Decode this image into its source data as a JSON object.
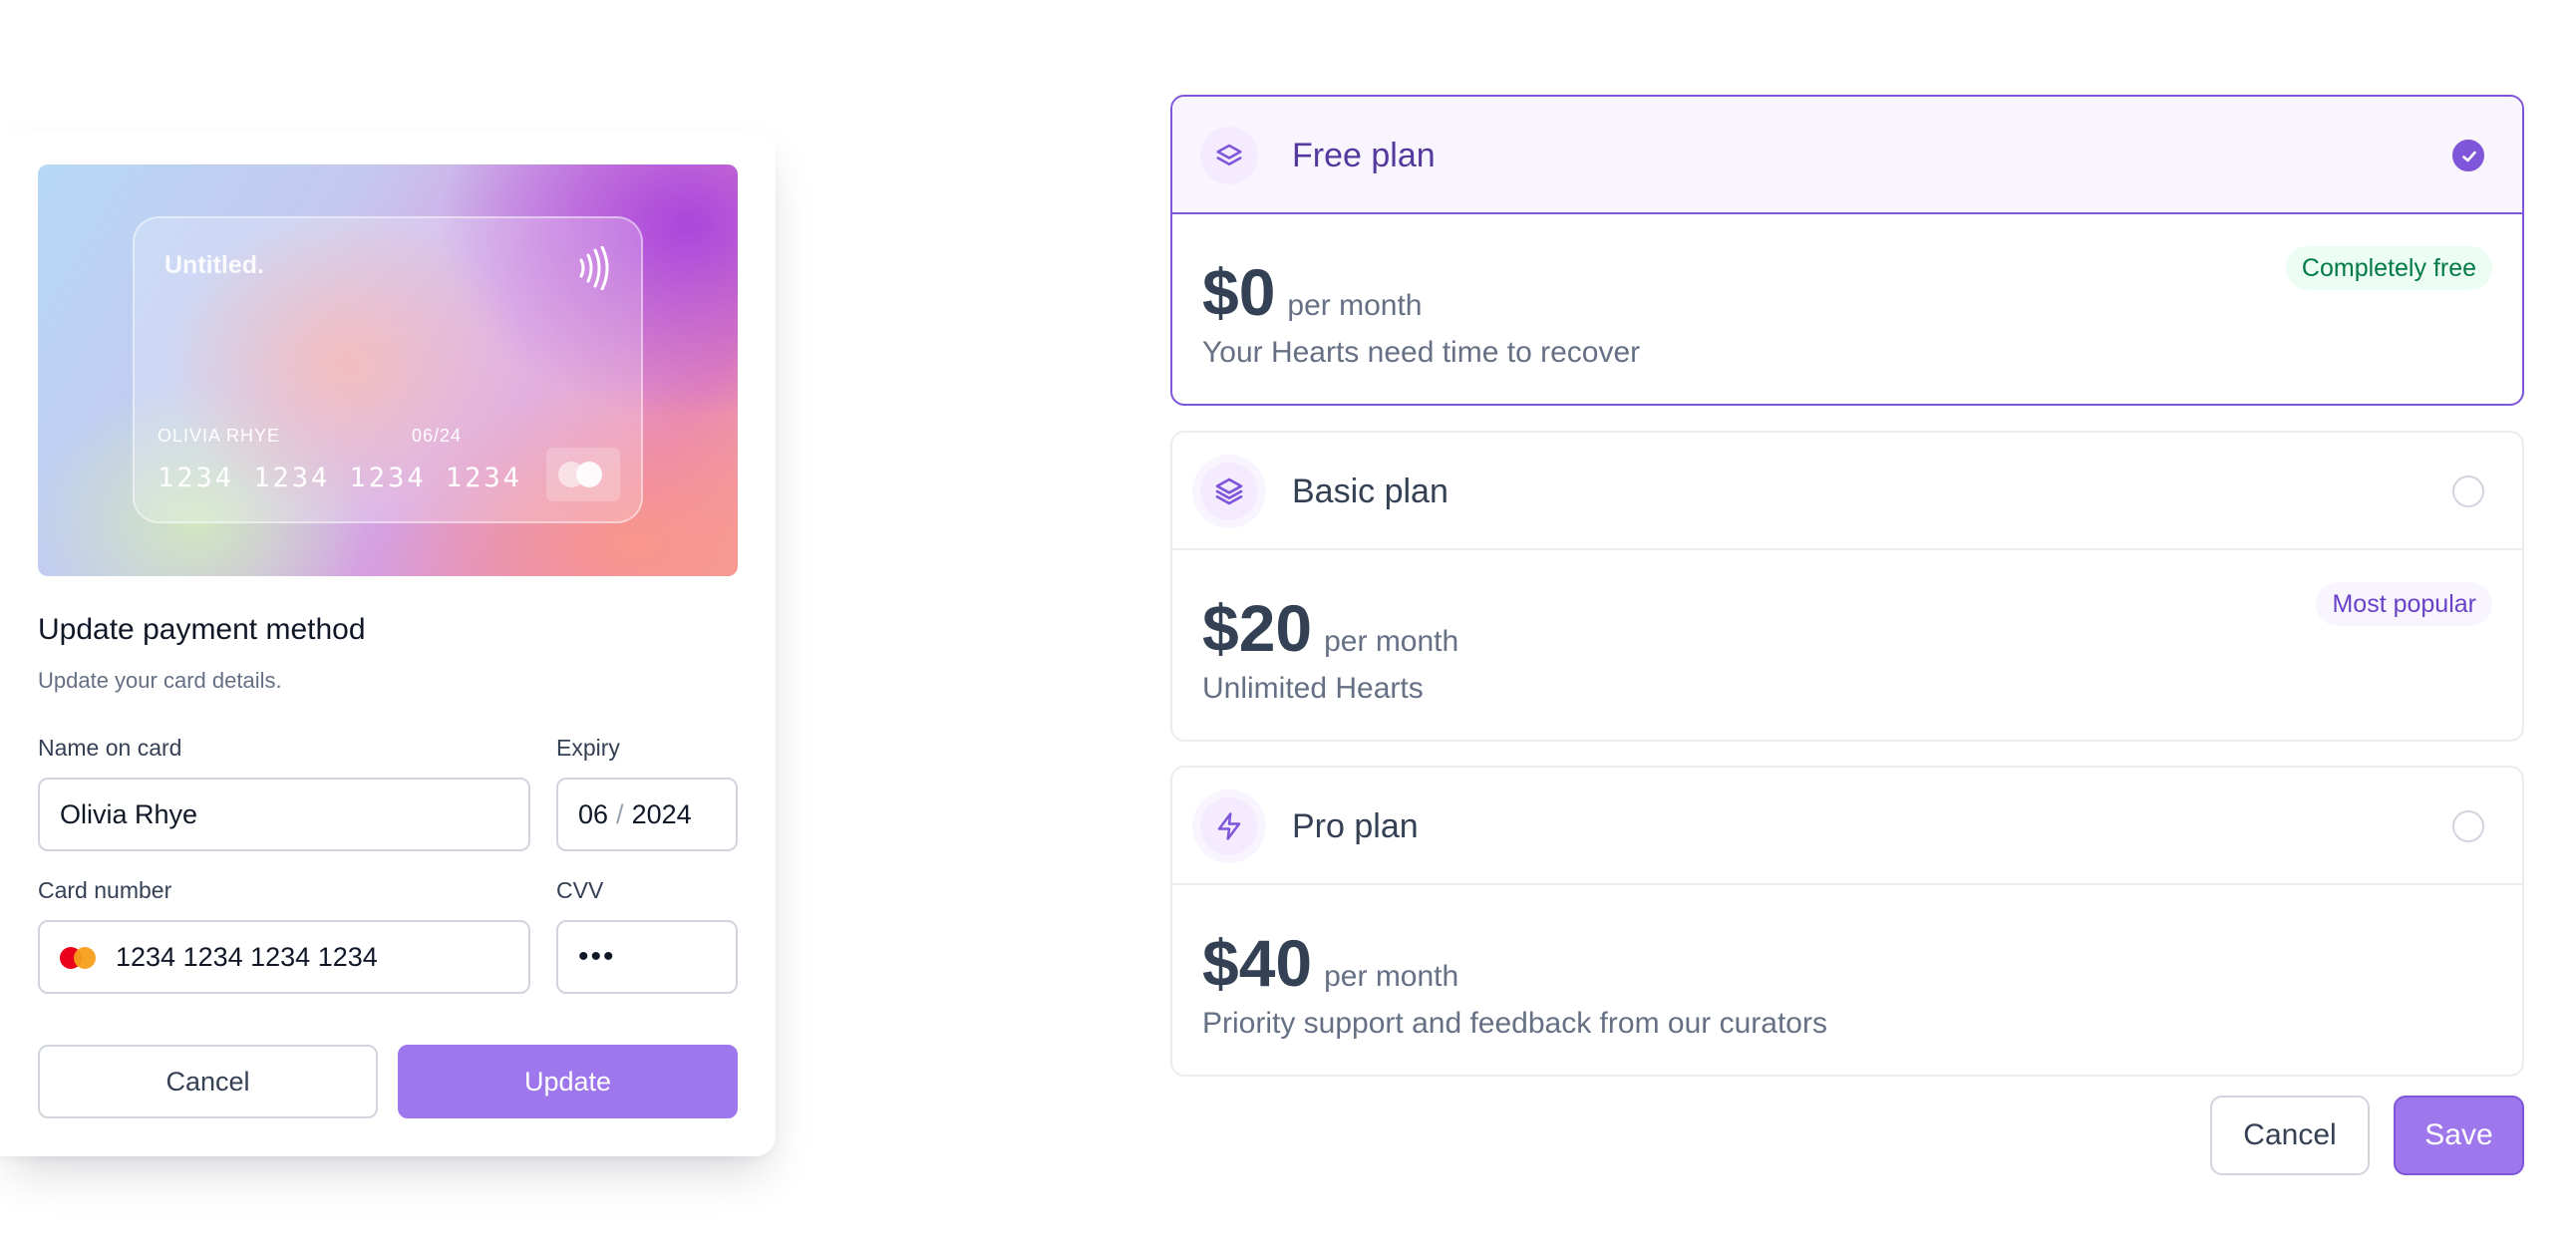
{
  "payment_modal": {
    "card": {
      "brand": "Untitled.",
      "holder": "OLIVIA RHYE",
      "expiry": "06/24",
      "number": "1234 1234 1234 1234"
    },
    "title": "Update payment method",
    "subtitle": "Update your card details.",
    "name_label": "Name on card",
    "name_value": "Olivia Rhye",
    "expiry_label": "Expiry",
    "expiry_month": "06",
    "expiry_sep": "/",
    "expiry_year": "2024",
    "card_number_label": "Card number",
    "card_number_value": "1234 1234 1234 1234",
    "cvv_label": "CVV",
    "cvv_value": "•••",
    "cancel_label": "Cancel",
    "update_label": "Update"
  },
  "plans": [
    {
      "name": "Free plan",
      "price": "$0",
      "unit": "per month",
      "description": "Your Hearts need time to recover",
      "badge": "Completely free",
      "selected": true,
      "icon": "layers-two-icon"
    },
    {
      "name": "Basic plan",
      "price": "$20",
      "unit": "per month",
      "description": "Unlimited Hearts",
      "badge": "Most popular",
      "selected": false,
      "icon": "layers-three-icon"
    },
    {
      "name": "Pro plan",
      "price": "$40",
      "unit": "per month",
      "description": "Priority support and feedback from our curators",
      "selected": false,
      "icon": "zap-icon"
    }
  ],
  "plan_actions": {
    "cancel_label": "Cancel",
    "save_label": "Save"
  },
  "colors": {
    "primary": "#7f56d9",
    "primary_light": "#9e77ed",
    "success": "#027a48"
  }
}
